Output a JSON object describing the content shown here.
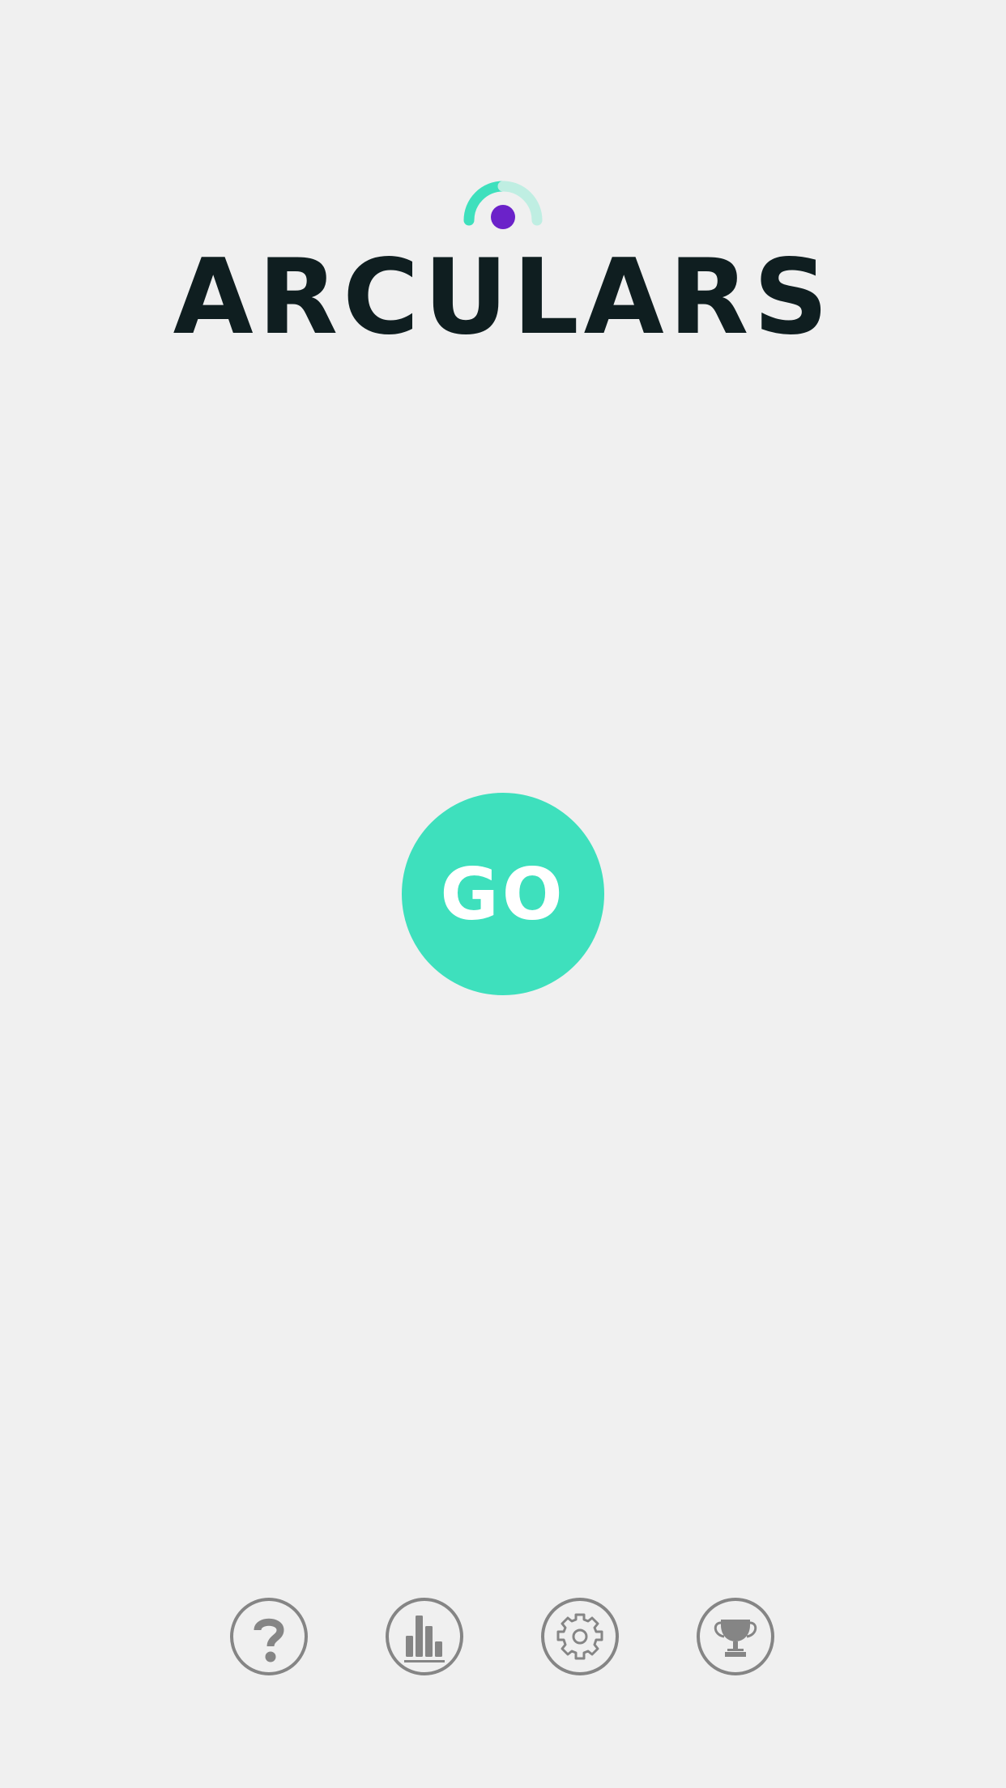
{
  "app": {
    "title": "ARCULARS"
  },
  "main": {
    "go_label": "GO"
  },
  "nav": {
    "items": [
      {
        "icon": "question-icon"
      },
      {
        "icon": "bar-chart-icon"
      },
      {
        "icon": "gear-icon"
      },
      {
        "icon": "trophy-icon"
      }
    ]
  },
  "colors": {
    "background": "#f0f0f0",
    "title": "#0f1e20",
    "accent": "#3ee0bd",
    "accent_light": "#bfeee2",
    "dot": "#6b22c9",
    "icon_gray": "#858585",
    "go_text": "#ffffff"
  }
}
